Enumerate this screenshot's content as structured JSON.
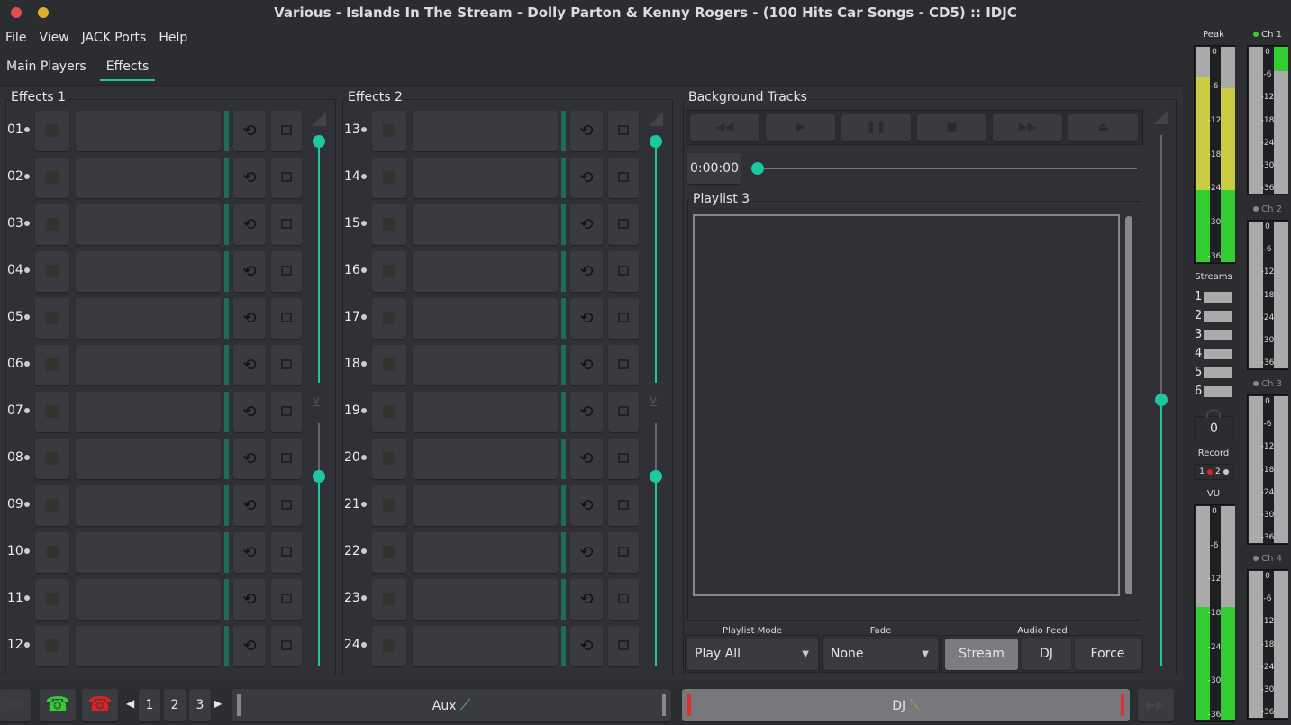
{
  "window": {
    "title": "Various - Islands In The Stream - Dolly Parton & Kenny Rogers - (100 Hits Car Songs - CD5) :: IDJC"
  },
  "menu": [
    "File",
    "View",
    "JACK Ports",
    "Help"
  ],
  "tabs": [
    {
      "label": "Main Players",
      "active": false
    },
    {
      "label": "Effects",
      "active": true
    }
  ],
  "effects1": {
    "title": "Effects 1",
    "rows": [
      "01",
      "02",
      "03",
      "04",
      "05",
      "06",
      "07",
      "08",
      "09",
      "10",
      "11",
      "12"
    ]
  },
  "effects2": {
    "title": "Effects 2",
    "rows": [
      "13",
      "14",
      "15",
      "16",
      "17",
      "18",
      "19",
      "20",
      "21",
      "22",
      "23",
      "24"
    ]
  },
  "background": {
    "title": "Background Tracks",
    "time": "0:00:00",
    "seek_position": 0,
    "volume_level": 0.5,
    "transport": [
      "rewind-icon",
      "play-icon",
      "pause-icon",
      "stop-icon",
      "fast-forward-icon",
      "eject-icon"
    ],
    "playlist_title": "Playlist 3",
    "playlist_mode": {
      "label": "Playlist Mode",
      "value": "Play All"
    },
    "fade": {
      "label": "Fade",
      "value": "None"
    },
    "audio_feed": {
      "label": "Audio Feed",
      "options": [
        "Stream",
        "DJ",
        "Force"
      ],
      "selected": "Stream"
    }
  },
  "meters": {
    "peak_label": "Peak",
    "scale": [
      "0",
      "-6",
      "-12",
      "-18",
      "-24",
      "-30",
      "-36"
    ],
    "peak_db": [
      -5,
      -7
    ],
    "vu_db": [
      -17,
      -17
    ],
    "channels": [
      {
        "label": "Ch 1",
        "active": true,
        "db": [
          null,
          -6
        ]
      },
      {
        "label": "Ch 2",
        "active": false
      },
      {
        "label": "Ch 3",
        "active": false
      },
      {
        "label": "Ch 4",
        "active": false
      }
    ],
    "streams_label": "Streams",
    "streams": [
      "1",
      "2",
      "3",
      "4",
      "5",
      "6"
    ],
    "listeners": "0",
    "record_label": "Record",
    "record": [
      "1",
      "2"
    ],
    "vu_label": "VU"
  },
  "bottom": {
    "dsp": "DSP",
    "pages": [
      "1",
      "2",
      "3"
    ],
    "aux": "Aux",
    "dj": "DJ"
  },
  "colors": {
    "accent": "#1bc8a0",
    "meter_green": "#33cc33",
    "meter_yellow": "#cccc44",
    "phone_green": "#33cc33",
    "phone_red": "#dd2222"
  }
}
